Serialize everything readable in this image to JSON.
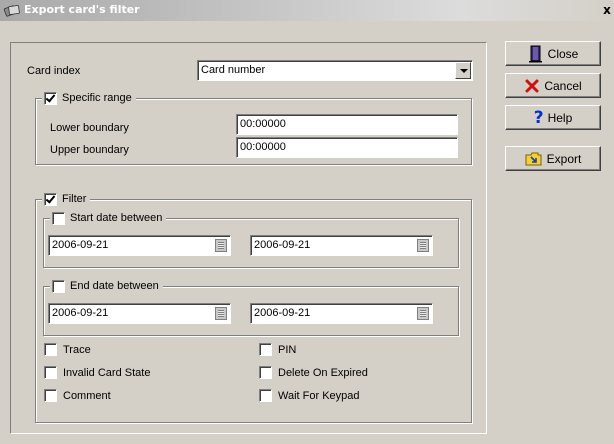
{
  "window": {
    "title": "Export card's filter",
    "close_glyph": "x",
    "icon": "cards-icon"
  },
  "form": {
    "card_index_label": "Card index",
    "card_index_value": "Card number",
    "specific_range": {
      "label": "Specific range",
      "checked": true,
      "lower_label": "Lower boundary",
      "lower_value": "00:00000",
      "upper_label": "Upper boundary",
      "upper_value": "00:00000"
    },
    "filter": {
      "label": "Filter",
      "checked": true,
      "start_date": {
        "label": "Start date between",
        "checked": false,
        "from": "2006-09-21",
        "to": "2006-09-21"
      },
      "end_date": {
        "label": "End date between",
        "checked": false,
        "from": "2006-09-21",
        "to": "2006-09-21"
      },
      "options": {
        "trace": "Trace",
        "pin": "PIN",
        "invalid_card_state": "Invalid Card State",
        "delete_on_expired": "Delete On Expired",
        "comment": "Comment",
        "wait_for_keypad": "Wait For Keypad"
      }
    }
  },
  "buttons": {
    "close": {
      "label": "Close",
      "icon": "door-icon"
    },
    "cancel": {
      "label": "Cancel",
      "icon": "red-x-icon"
    },
    "help": {
      "label": "Help",
      "icon": "question-icon"
    },
    "export": {
      "label": "Export",
      "icon": "folder-arrow-icon"
    }
  },
  "colors": {
    "face": "#d4d0c8",
    "title_text": "#ffffff",
    "cancel_icon": "#cc1111",
    "help_icon": "#0033cc"
  }
}
